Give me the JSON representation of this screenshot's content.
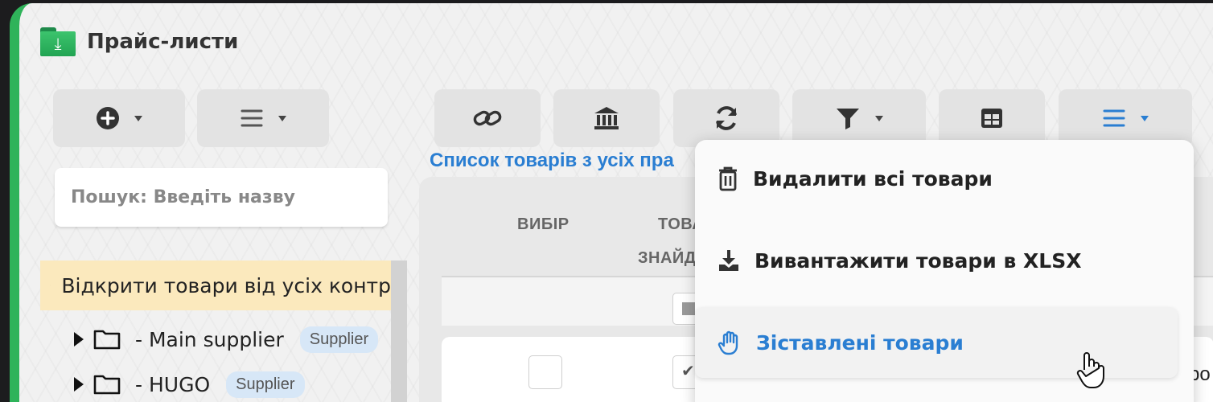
{
  "app": {
    "title": "Прайс-листи"
  },
  "left_toolbar": {
    "add_icon": "plus-circle-icon",
    "menu_icon": "hamburger-icon"
  },
  "search": {
    "placeholder": "Пошук: Введіть назву"
  },
  "tree": {
    "root_label": "Відкрити товари від усіх контр",
    "items": [
      {
        "label": "- Main supplier",
        "badge": "Supplier"
      },
      {
        "label": "- HUGO",
        "badge": "Supplier"
      }
    ]
  },
  "main_toolbar": {
    "icons": [
      "link-icon",
      "bank-icon",
      "refresh-icon",
      "filter-icon",
      "table-icon",
      "hamburger-icon"
    ]
  },
  "table": {
    "list_title": "Список товарів з усіх пра",
    "headers": {
      "select": "ВИБІР",
      "product_line1": "ТОВА",
      "product_line2": "ЗНАЙД"
    },
    "row_text": "ро"
  },
  "dropdown": {
    "items": [
      {
        "label": "Видалити всі товари",
        "icon": "trash-icon"
      },
      {
        "label": "Вивантажити товари в XLSX",
        "icon": "download-icon"
      },
      {
        "label": "Зіставлені товари",
        "icon": "hand-icon",
        "active": true
      }
    ]
  },
  "colors": {
    "accent": "#2a7ed2",
    "brand_green": "#2fb35a",
    "tree_highlight": "#fbe9bd"
  }
}
